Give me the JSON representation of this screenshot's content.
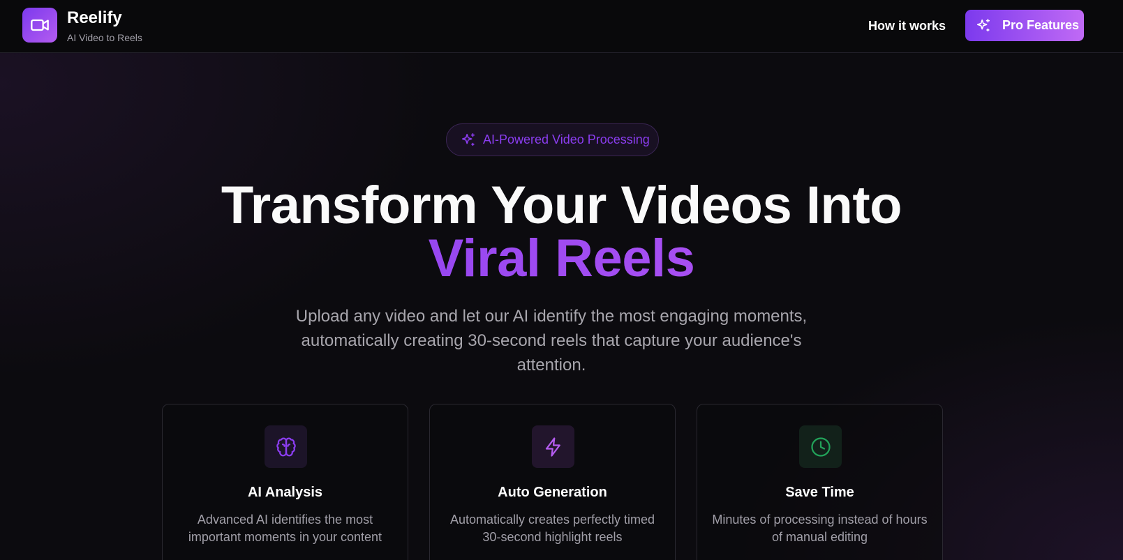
{
  "header": {
    "brand_name": "Reelify",
    "brand_tagline": "AI Video to Reels",
    "nav_how_it_works": "How it works",
    "pro_button_label": "Pro Features"
  },
  "hero": {
    "badge_label": "AI-Powered Video Processing",
    "title_line1": "Transform Your Videos Into",
    "title_line2": "Viral Reels",
    "subtitle": "Upload any video and let our AI identify the most engaging moments, automatically creating 30-second reels that capture your audience's attention."
  },
  "features": [
    {
      "icon": "brain-icon",
      "title": "AI Analysis",
      "description": "Advanced AI identifies the most important moments in your content"
    },
    {
      "icon": "lightning-icon",
      "title": "Auto Generation",
      "description": "Automatically creates perfectly timed 30-second highlight reels"
    },
    {
      "icon": "clock-icon",
      "title": "Save Time",
      "description": "Minutes of processing instead of hours of manual editing"
    }
  ],
  "colors": {
    "accent_purple": "#7c3aed",
    "accent_purple_light": "#c35cf5",
    "green": "#22a35a"
  }
}
